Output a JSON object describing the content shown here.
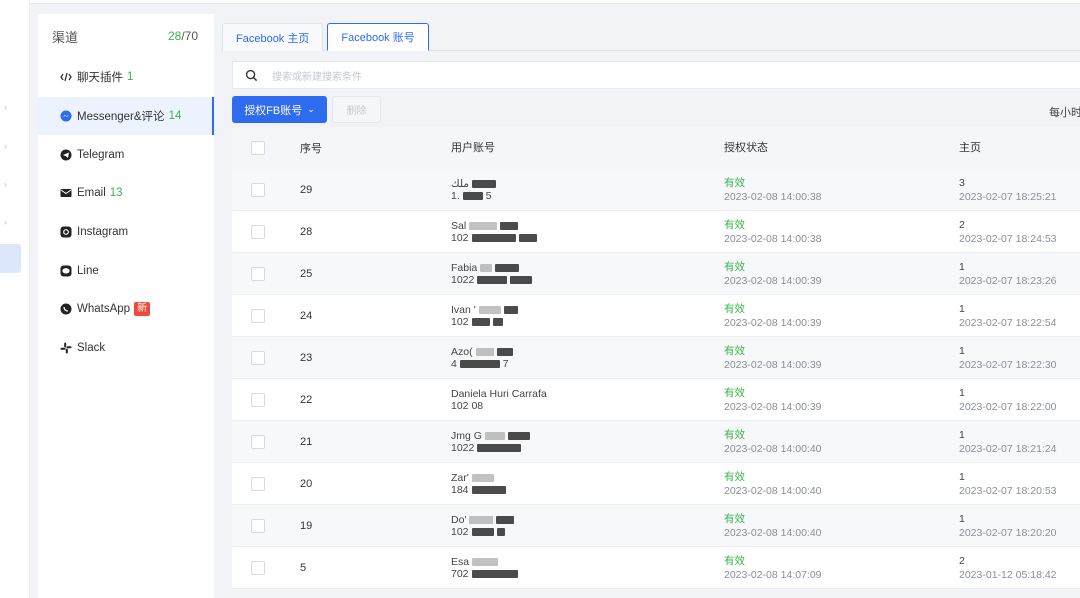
{
  "channels": {
    "title": "渠道",
    "count_used": "28",
    "count_total": "/70",
    "items": [
      {
        "label": "聊天插件",
        "num": "1",
        "icon": "chat-plugin-icon"
      },
      {
        "label": "Messenger&评论",
        "num": "14",
        "icon": "messenger-icon"
      },
      {
        "label": "Telegram",
        "num": "",
        "icon": "telegram-icon"
      },
      {
        "label": "Email",
        "num": "13",
        "icon": "email-icon"
      },
      {
        "label": "Instagram",
        "num": "",
        "icon": "instagram-icon"
      },
      {
        "label": "Line",
        "num": "",
        "icon": "line-icon"
      },
      {
        "label": "WhatsApp",
        "num": "",
        "icon": "whatsapp-icon",
        "badge": "新"
      },
      {
        "label": "Slack",
        "num": "",
        "icon": "slack-icon"
      }
    ]
  },
  "tabs": [
    {
      "label": "Facebook 主页"
    },
    {
      "label": "Facebook 账号"
    }
  ],
  "search": {
    "placeholder": "搜索或新建搜索条件"
  },
  "toolbar": {
    "authorize_label": "授权FB账号",
    "delete_label": "删除",
    "right_hint": "每小时"
  },
  "table": {
    "headers": {
      "no": "序号",
      "user": "用户账号",
      "status": "授权状态",
      "page": "主页"
    },
    "rows": [
      {
        "no": "29",
        "user1": "ملك",
        "user2": "1.",
        "user2_tail": "5",
        "status": "有效",
        "status_time": "2023-02-08 14:00:38",
        "page": "3",
        "page_time": "2023-02-07 18:25:21"
      },
      {
        "no": "28",
        "user1": "Sal",
        "user2": "102",
        "user2_tail": "",
        "status": "有效",
        "status_time": "2023-02-08 14:00:38",
        "page": "2",
        "page_time": "2023-02-07 18:24:53"
      },
      {
        "no": "25",
        "user1": "Fabia",
        "user2": "1022",
        "user2_tail": "",
        "status": "有效",
        "status_time": "2023-02-08 14:00:39",
        "page": "1",
        "page_time": "2023-02-07 18:23:26"
      },
      {
        "no": "24",
        "user1": "Ivan '",
        "user2": "102",
        "user2_tail": "",
        "status": "有效",
        "status_time": "2023-02-08 14:00:39",
        "page": "1",
        "page_time": "2023-02-07 18:22:54"
      },
      {
        "no": "23",
        "user1": "Azo(",
        "user2": "4",
        "user2_tail": "7",
        "status": "有效",
        "status_time": "2023-02-08 14:00:39",
        "page": "1",
        "page_time": "2023-02-07 18:22:30"
      },
      {
        "no": "22",
        "user1": "Daniela Huri Carrafa",
        "user2": "102",
        "user2_tail": "08",
        "status": "有效",
        "status_time": "2023-02-08 14:00:39",
        "page": "1",
        "page_time": "2023-02-07 18:22:00"
      },
      {
        "no": "21",
        "user1": "Jmg G",
        "user2": "1022",
        "user2_tail": "",
        "status": "有效",
        "status_time": "2023-02-08 14:00:40",
        "page": "1",
        "page_time": "2023-02-07 18:21:24"
      },
      {
        "no": "20",
        "user1": "Zar'",
        "user2": "184",
        "user2_tail": "",
        "status": "有效",
        "status_time": "2023-02-08 14:00:40",
        "page": "1",
        "page_time": "2023-02-07 18:20:53"
      },
      {
        "no": "19",
        "user1": "Do'",
        "user2": "102",
        "user2_tail": "",
        "status": "有效",
        "status_time": "2023-02-08 14:00:40",
        "page": "1",
        "page_time": "2023-02-07 18:20:20"
      },
      {
        "no": "5",
        "user1": "Esa",
        "user2": "702",
        "user2_tail": "",
        "status": "有效",
        "status_time": "2023-02-08 14:07:09",
        "page": "2",
        "page_time": "2023-01-12 05:18:42"
      }
    ]
  }
}
